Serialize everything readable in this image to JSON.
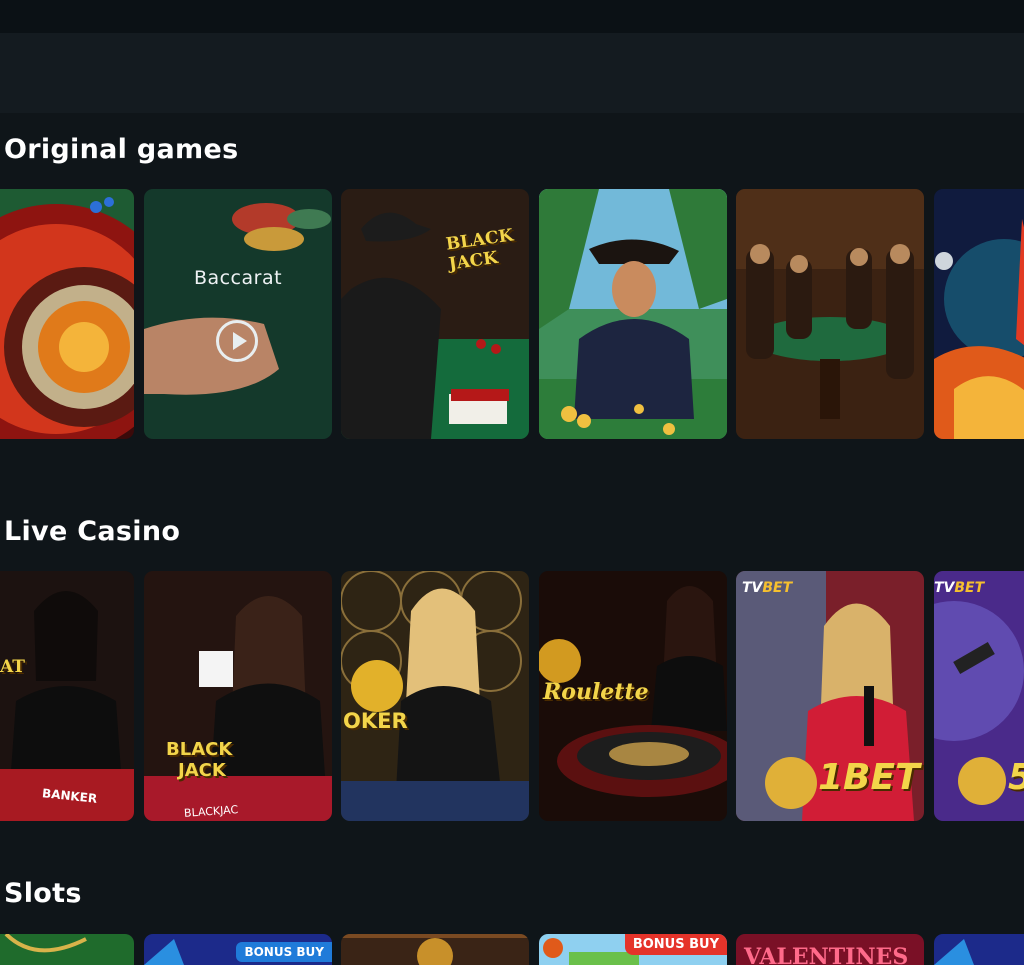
{
  "sections": {
    "original": {
      "title": "Original games",
      "cards": [
        {
          "name": "roulette"
        },
        {
          "name": "baccarat",
          "overlay": "Baccarat"
        },
        {
          "name": "blackjack",
          "sign": "BLACK JACK"
        },
        {
          "name": "pirate"
        },
        {
          "name": "cowboys-poker"
        },
        {
          "name": "rocket"
        }
      ]
    },
    "live": {
      "title": "Live Casino",
      "cards": [
        {
          "name": "baccarat-live",
          "word": "AT",
          "table_text": "BANKER"
        },
        {
          "name": "blackjack-live",
          "word1": "BLACK",
          "word2": "JACK",
          "table_text": "BLACKJAC"
        },
        {
          "name": "poker-live",
          "word": "OKER"
        },
        {
          "name": "roulette-live",
          "word": "Roulette"
        },
        {
          "name": "tvbet-1bet",
          "brand_a": "TV",
          "brand_b": "BET",
          "game": "1BET"
        },
        {
          "name": "tvbet-5bet",
          "brand_a": "TV",
          "brand_b": "BET",
          "game": "5"
        }
      ]
    },
    "slots": {
      "title": "Slots",
      "cards": [
        {
          "name": "slot-green"
        },
        {
          "name": "slot-blue",
          "badge": "BONUS BUY"
        },
        {
          "name": "slot-egypt"
        },
        {
          "name": "slot-bright",
          "badge": "BONUS BUY"
        },
        {
          "name": "slot-valentine",
          "word": "VALENTINES"
        },
        {
          "name": "slot-blue2"
        }
      ]
    }
  },
  "colors": {
    "background": "#0f1519",
    "topbar": "#0b1115",
    "banner": "#141b20",
    "badge_blue": "#1f7bd9",
    "badge_red": "#e5332a"
  }
}
